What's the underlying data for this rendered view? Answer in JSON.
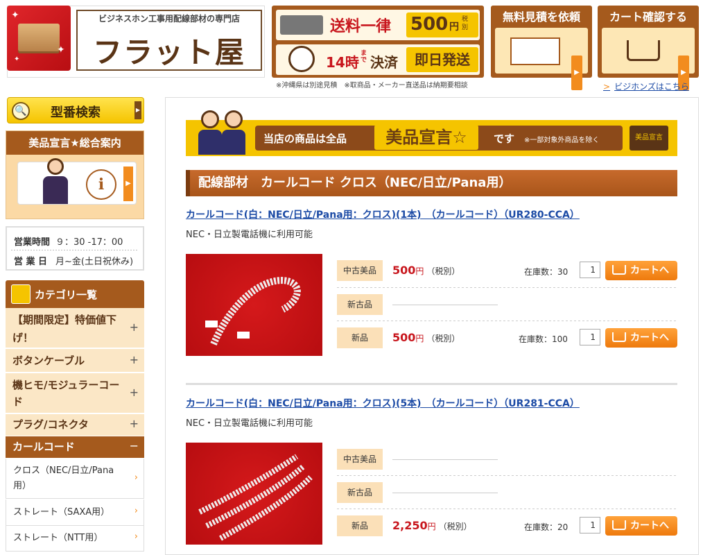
{
  "header": {
    "logo_tagline": "ビジネスホン工事用配線部材の専門店",
    "logo_name": "フラット屋",
    "shipping": {
      "flat_label": "送料一律",
      "flat_price": "500",
      "flat_unit": "円",
      "flat_tax": "税別",
      "cutoff": "14時",
      "cutoff_suffix": "まで",
      "cutoff_label": "決済",
      "same_day": "即日発送"
    },
    "notes": "※沖縄県は別途見積　※取商品・メーカー直送品は納期要相談",
    "quote_button": "無料見積を依頼",
    "cart_button": "カート確認する",
    "business_link": "ビジホンズはこちら"
  },
  "sidebar": {
    "model_search": "型番検索",
    "guide_title": "美品宣言★総合案内",
    "hours_label": "営業時間",
    "hours_value": "９：30 -17：00",
    "days_label": "営 業 日",
    "days_value": "月~金(土日祝休み)",
    "category_title": "カテゴリ一覧",
    "categories": [
      {
        "label_1": "【期間限定】特価値下",
        "label_2": "げ！",
        "toggle": "+"
      },
      {
        "label_1": "ボタンケーブル",
        "toggle": "+"
      },
      {
        "label_1": "機ヒモ/モジュラーコー",
        "label_2": "ド",
        "toggle": "+"
      },
      {
        "label_1": "プラグ/コネクタ",
        "toggle": "+"
      },
      {
        "label_1": "カールコード",
        "toggle": "−"
      }
    ],
    "subcategories": [
      {
        "label_1": "クロス（NEC/日立/Pana",
        "label_2": "用）"
      },
      {
        "label_1": "ストレート（SAXA用）"
      },
      {
        "label_1": "ストレート（NTT用）"
      }
    ]
  },
  "banner": {
    "text_1": "当店の商品は全品",
    "text_2": "美品宣言☆",
    "text_3": "です",
    "text_4": "※一部対象外商品を除く",
    "seal": "美品宣言"
  },
  "section_title": "配線部材　カールコード クロス（NEC/日立/Pana用）",
  "products": [
    {
      "title": "カールコード(白：NEC/日立/Pana用：クロス)(1本)　（カールコード）（UR280-CCA）",
      "description": "NEC・日立製電話機に利用可能",
      "rows": [
        {
          "condition": "中古美品",
          "price": "500",
          "yen": "円",
          "tax": "（税別）",
          "stock": "在庫数：30",
          "qty": "1",
          "cart": "カートへ"
        },
        {
          "condition": "新古品"
        },
        {
          "condition": "新品",
          "price": "500",
          "yen": "円",
          "tax": "（税別）",
          "stock": "在庫数：100",
          "qty": "1",
          "cart": "カートへ"
        }
      ]
    },
    {
      "title": "カールコード(白：NEC/日立/Pana用：クロス)(5本)　（カールコード）（UR281-CCA）",
      "description": "NEC・日立製電話機に利用可能",
      "rows": [
        {
          "condition": "中古美品"
        },
        {
          "condition": "新古品"
        },
        {
          "condition": "新品",
          "price": "2,250",
          "yen": "円",
          "tax": "（税別）",
          "stock": "在庫数：20",
          "qty": "1",
          "cart": "カートへ"
        }
      ]
    }
  ],
  "colors": {
    "brand_brown": "#a55a1d",
    "accent_orange": "#f28c1e",
    "price_red": "#c8161d",
    "yellow": "#f5c400",
    "link_blue": "#1b4aa5"
  }
}
